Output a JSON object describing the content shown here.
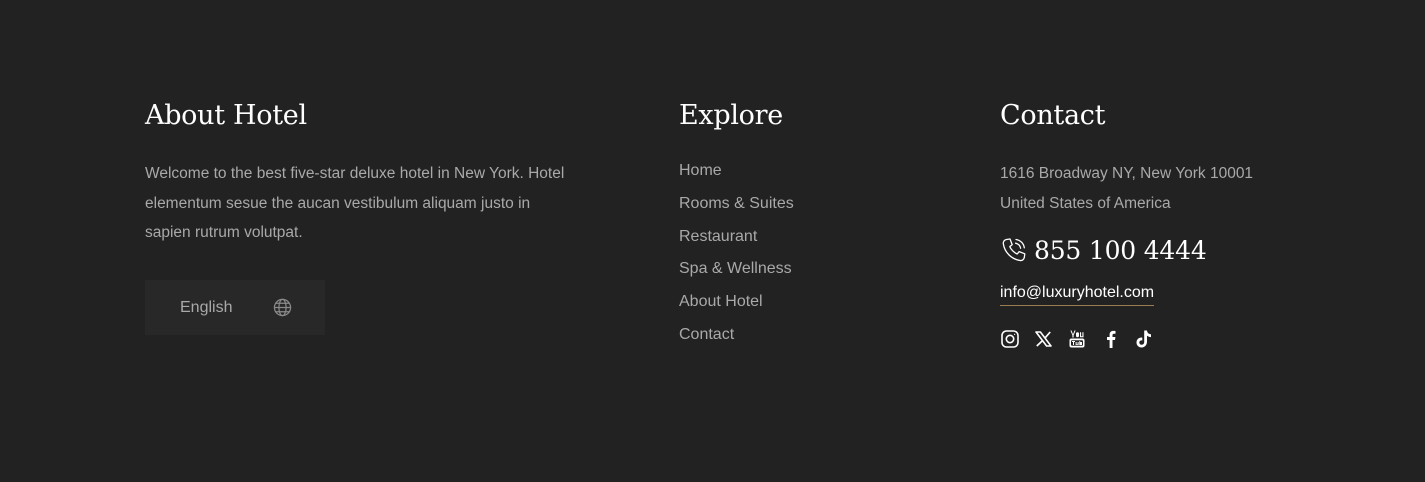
{
  "about": {
    "heading": "About Hotel",
    "text": "Welcome to the best five-star deluxe hotel in New York. Hotel elementum sesue the aucan vestibulum aliquam justo in sapien rutrum volutpat.",
    "language_label": "English",
    "language_icon": "globe-icon"
  },
  "explore": {
    "heading": "Explore",
    "links": [
      "Home",
      "Rooms & Suites",
      "Restaurant",
      "Spa & Wellness",
      "About Hotel",
      "Contact"
    ]
  },
  "contact": {
    "heading": "Contact",
    "address_line1": "1616 Broadway NY, New York 10001",
    "address_line2": "United States of America",
    "phone_icon": "phone-icon",
    "phone": "855 100 4444",
    "email": "info@luxuryhotel.com",
    "socials": [
      "instagram-icon",
      "x-twitter-icon",
      "youtube-icon",
      "facebook-icon",
      "tiktok-icon"
    ]
  },
  "colors": {
    "background": "#222222",
    "button_background": "#282828",
    "heading": "#ffffff",
    "text": "#a9a9a9",
    "accent_underline": "#9a7e52"
  }
}
